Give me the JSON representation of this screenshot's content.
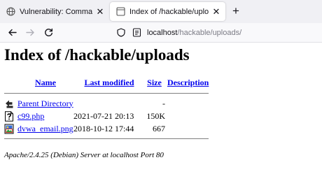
{
  "browser": {
    "tabs": [
      {
        "title": "Vulnerability: Command Injection",
        "active": false,
        "close_glyph": "✕"
      },
      {
        "title": "Index of /hackable/uploads",
        "active": true,
        "close_glyph": "✕"
      }
    ],
    "new_tab_glyph": "+",
    "url_host": "localhost",
    "url_path": "/hackable/uploads/"
  },
  "page": {
    "heading": "Index of /hackable/uploads",
    "columns": {
      "name": "Name",
      "last_modified": "Last modified",
      "size": "Size",
      "description": "Description"
    },
    "parent": {
      "label": "Parent Directory",
      "size": "-",
      "icon": "back-icon"
    },
    "files": [
      {
        "name": "c99.php",
        "modified": "2021-07-21 20:13",
        "size": "150K",
        "icon": "unknown-file-icon"
      },
      {
        "name": "dvwa_email.png",
        "modified": "2018-10-12 17:44",
        "size": "667",
        "icon": "image-file-icon"
      }
    ],
    "footer": "Apache/2.4.25 (Debian) Server at localhost Port 80"
  },
  "colors": {
    "link": "#0000ee",
    "tabbar": "#f0f0f4",
    "navbar": "#f9f9fb"
  }
}
